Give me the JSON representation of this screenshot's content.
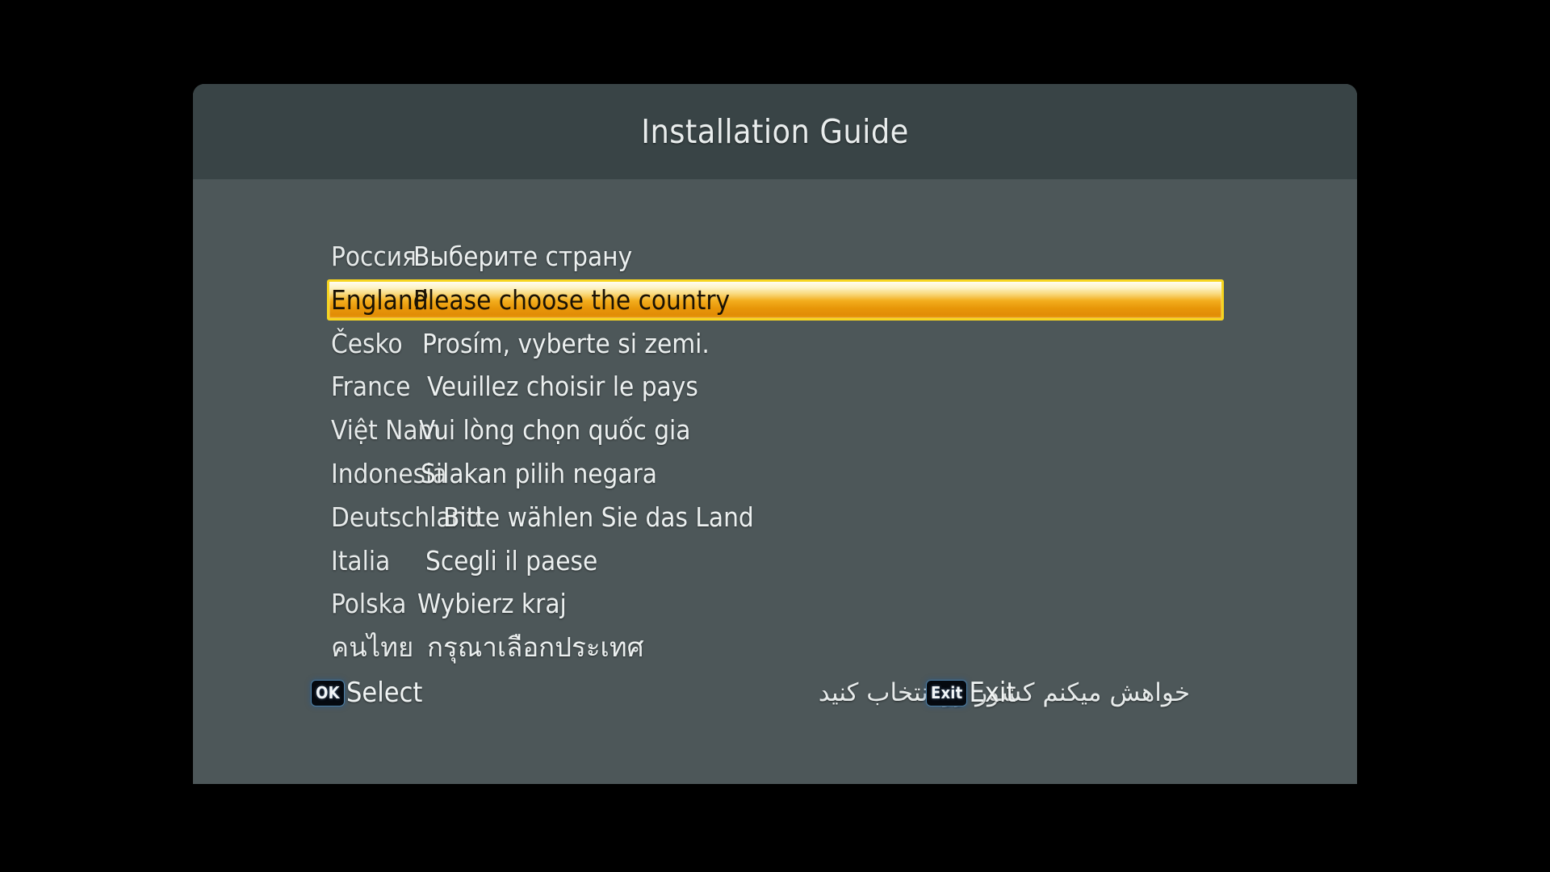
{
  "screen": {
    "background_color": "#000000"
  },
  "dialog": {
    "header": {
      "title": "Installation Guide",
      "background_color": "#394446",
      "text_color": "#e9eded"
    },
    "body": {
      "background_color": "#4d5759"
    }
  },
  "language_list": {
    "selected_index": 1,
    "highlight": {
      "border_color": "#f7d520",
      "gradient_top_color": "#fffdf0",
      "gradient_bottom_color": "#e28c06",
      "text_color": "#1a1205"
    },
    "rows": [
      {
        "native": "Россия",
        "prompt": "Выберите страну",
        "selected": false
      },
      {
        "native": "England",
        "prompt": "Please choose the country",
        "selected": true
      },
      {
        "native": "Česko",
        "prompt": "Prosím, vyberte si zemi.",
        "selected": false
      },
      {
        "native": "France",
        "prompt": "Veuillez choisir le pays",
        "selected": false
      },
      {
        "native": "Việt Nam",
        "prompt": "Vui lòng chọn quốc gia",
        "selected": false
      },
      {
        "native": "Indonesia",
        "prompt": "Silakan pilih negara",
        "selected": false
      },
      {
        "native": "Deutschland",
        "prompt": "Bitte wählen Sie das Land",
        "selected": false
      },
      {
        "native": "Italia",
        "prompt": "Scegli il paese",
        "selected": false
      },
      {
        "native": "Polska",
        "prompt": "Wybierz kraj",
        "selected": false
      },
      {
        "native": "คนไทย",
        "prompt": "กรุณาเลือกประเทศ",
        "selected": false
      }
    ],
    "persian_prompt": "خواهش میکنم کشور رو انتخاب کنید"
  },
  "footer": {
    "hints": [
      {
        "badge": "OK",
        "label": "Select"
      },
      {
        "badge": "Exit",
        "label": "Exit"
      }
    ]
  }
}
